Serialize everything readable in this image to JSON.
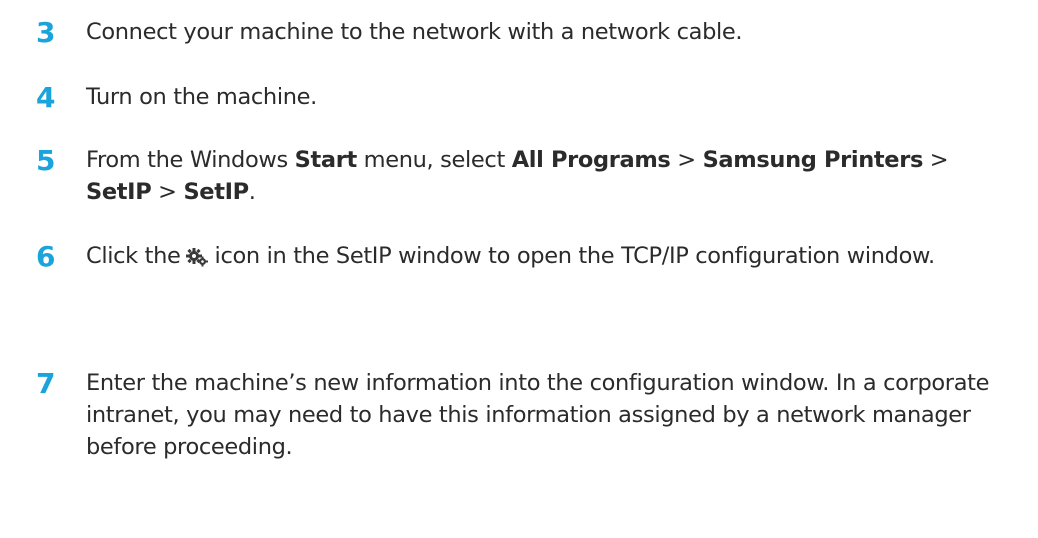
{
  "steps": [
    {
      "number": "3",
      "text": "Connect your machine to the network with a network cable."
    },
    {
      "number": "4",
      "text": "Turn on the machine."
    },
    {
      "number": "5",
      "from": "From the Windows ",
      "start": "Start",
      "menu_select": " menu, select ",
      "all_programs": "All Programs",
      "sep1": " > ",
      "samsung_printers": "Samsung Printers",
      "sep2": " > ",
      "setip1": "SetIP",
      "sep3": " > ",
      "setip2": "SetIP",
      "period": "."
    },
    {
      "number": "6",
      "click_the": "Click the",
      "icon": "setip-configuration-icon",
      "rest": "icon in the SetIP window to open the TCP/IP configuration window."
    },
    {
      "number": "7",
      "text": "Enter the machine’s new information into the configuration window. In a corporate intranet, you may need to have this information assigned by a network manager before proceeding."
    }
  ],
  "colors": {
    "step_number": "#1ba3dc",
    "body_text": "#2b2b2b",
    "icon": "#3a3a3a"
  }
}
